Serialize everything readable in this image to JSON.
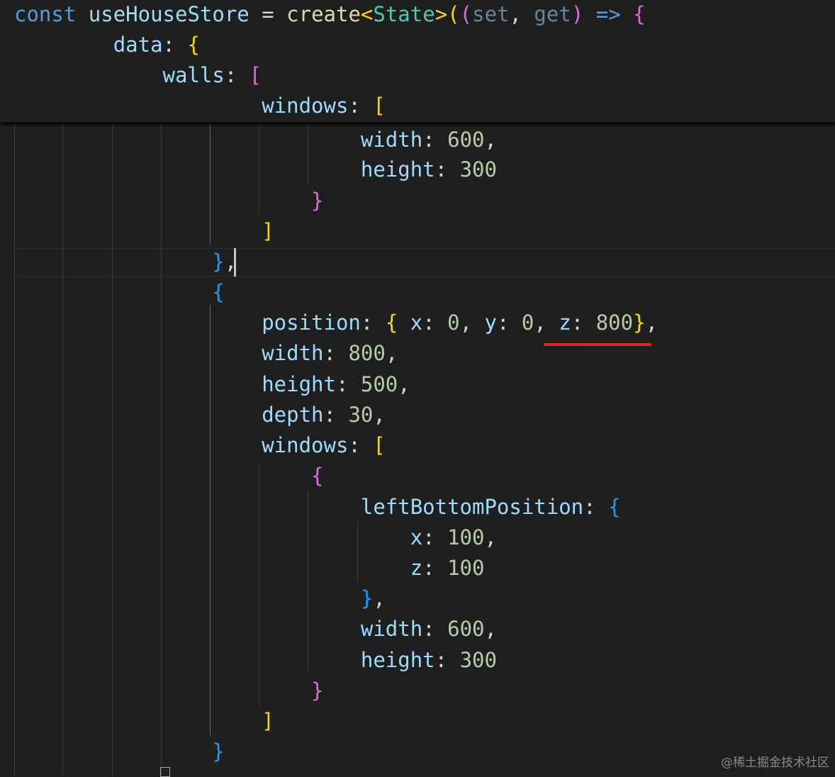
{
  "editor": {
    "sticky_lines": [
      [
        {
          "t": "const",
          "c": "kw"
        },
        {
          "t": " "
        },
        {
          "t": "useHouseStore",
          "c": "pr"
        },
        {
          "t": " = "
        },
        {
          "t": "create",
          "c": "fn"
        },
        {
          "t": "<",
          "c": "b1"
        },
        {
          "t": "State",
          "c": "ty"
        },
        {
          "t": ">",
          "c": "b1"
        },
        {
          "t": "(",
          "c": "b1"
        },
        {
          "t": "(",
          "c": "b2"
        },
        {
          "t": "set",
          "c": "param"
        },
        {
          "t": ", "
        },
        {
          "t": "get",
          "c": "param"
        },
        {
          "t": ")",
          "c": "b2"
        },
        {
          "t": " "
        },
        {
          "t": "=>",
          "c": "kw"
        },
        {
          "t": " "
        },
        {
          "t": "{",
          "c": "b2"
        }
      ],
      [
        {
          "t": "        "
        },
        {
          "t": "data",
          "c": "pr"
        },
        {
          "t": ": "
        },
        {
          "t": "{",
          "c": "b1"
        }
      ],
      [
        {
          "t": "            "
        },
        {
          "t": "walls",
          "c": "pr"
        },
        {
          "t": ": "
        },
        {
          "t": "[",
          "c": "b2"
        }
      ],
      [
        {
          "t": "                    "
        },
        {
          "t": "windows",
          "c": "pr"
        },
        {
          "t": ": "
        },
        {
          "t": "[",
          "c": "b1"
        }
      ]
    ],
    "lines": [
      [
        {
          "t": "                            "
        },
        {
          "t": "width",
          "c": "pr"
        },
        {
          "t": ": "
        },
        {
          "t": "600",
          "c": "nu"
        },
        {
          "t": ","
        }
      ],
      [
        {
          "t": "                            "
        },
        {
          "t": "height",
          "c": "pr"
        },
        {
          "t": ": "
        },
        {
          "t": "300",
          "c": "nu"
        }
      ],
      [
        {
          "t": "                        "
        },
        {
          "t": "}",
          "c": "b2"
        }
      ],
      [
        {
          "t": "                    "
        },
        {
          "t": "]",
          "c": "b1"
        }
      ],
      [
        {
          "t": "                "
        },
        {
          "t": "}",
          "c": "b3"
        },
        {
          "t": ","
        }
      ],
      [
        {
          "t": "                "
        },
        {
          "t": "{",
          "c": "b3"
        }
      ],
      [
        {
          "t": "                    "
        },
        {
          "t": "position",
          "c": "pr"
        },
        {
          "t": ": "
        },
        {
          "t": "{",
          "c": "b1"
        },
        {
          "t": " "
        },
        {
          "t": "x",
          "c": "pr"
        },
        {
          "t": ": "
        },
        {
          "t": "0",
          "c": "nu"
        },
        {
          "t": ", "
        },
        {
          "t": "y",
          "c": "pr"
        },
        {
          "t": ": "
        },
        {
          "t": "0",
          "c": "nu"
        },
        {
          "t": ", "
        },
        {
          "t": "z",
          "c": "pr"
        },
        {
          "t": ": "
        },
        {
          "t": "800",
          "c": "nu"
        },
        {
          "t": "}",
          "c": "b1"
        },
        {
          "t": ","
        }
      ],
      [
        {
          "t": "                    "
        },
        {
          "t": "width",
          "c": "pr"
        },
        {
          "t": ": "
        },
        {
          "t": "800",
          "c": "nu"
        },
        {
          "t": ","
        }
      ],
      [
        {
          "t": "                    "
        },
        {
          "t": "height",
          "c": "pr"
        },
        {
          "t": ": "
        },
        {
          "t": "500",
          "c": "nu"
        },
        {
          "t": ","
        }
      ],
      [
        {
          "t": "                    "
        },
        {
          "t": "depth",
          "c": "pr"
        },
        {
          "t": ": "
        },
        {
          "t": "30",
          "c": "nu"
        },
        {
          "t": ","
        }
      ],
      [
        {
          "t": "                    "
        },
        {
          "t": "windows",
          "c": "pr"
        },
        {
          "t": ": "
        },
        {
          "t": "[",
          "c": "b1"
        }
      ],
      [
        {
          "t": "                        "
        },
        {
          "t": "{",
          "c": "b2"
        }
      ],
      [
        {
          "t": "                            "
        },
        {
          "t": "leftBottomPosition",
          "c": "pr"
        },
        {
          "t": ": "
        },
        {
          "t": "{",
          "c": "b3"
        }
      ],
      [
        {
          "t": "                                "
        },
        {
          "t": "x",
          "c": "pr"
        },
        {
          "t": ": "
        },
        {
          "t": "100",
          "c": "nu"
        },
        {
          "t": ","
        }
      ],
      [
        {
          "t": "                                "
        },
        {
          "t": "z",
          "c": "pr"
        },
        {
          "t": ": "
        },
        {
          "t": "100",
          "c": "nu"
        }
      ],
      [
        {
          "t": "                            "
        },
        {
          "t": "}",
          "c": "b3"
        },
        {
          "t": ","
        }
      ],
      [
        {
          "t": "                            "
        },
        {
          "t": "width",
          "c": "pr"
        },
        {
          "t": ": "
        },
        {
          "t": "600",
          "c": "nu"
        },
        {
          "t": ","
        }
      ],
      [
        {
          "t": "                            "
        },
        {
          "t": "height",
          "c": "pr"
        },
        {
          "t": ": "
        },
        {
          "t": "300",
          "c": "nu"
        }
      ],
      [
        {
          "t": "                        "
        },
        {
          "t": "}",
          "c": "b2"
        }
      ],
      [
        {
          "t": "                    "
        },
        {
          "t": "]",
          "c": "b1"
        }
      ],
      [
        {
          "t": "                "
        },
        {
          "t": "}",
          "c": "b3"
        }
      ]
    ]
  },
  "annotation": {
    "highlighted_text": "z: 800",
    "underline_color": "#e5261f"
  },
  "watermark": "@稀土掘金技术社区"
}
